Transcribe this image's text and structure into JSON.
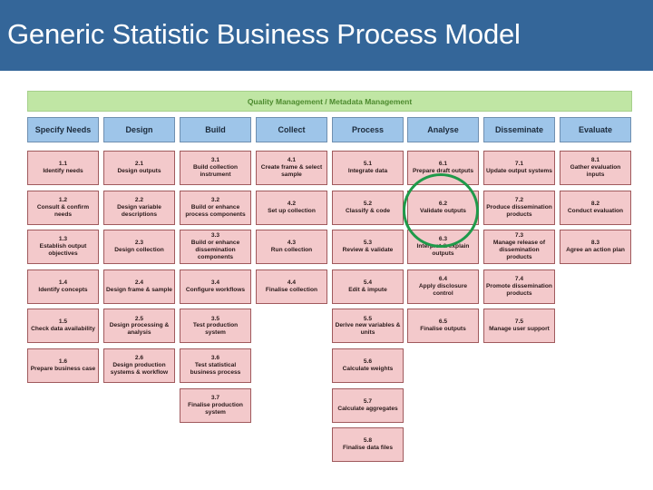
{
  "title": "Generic Statistic Business Process Model",
  "quality_bar": "Quality Management / Metadata Management",
  "colors": {
    "title_bg": "#346699",
    "quality_bg": "#c0e6a4",
    "phase_bg": "#9ec5e9",
    "subprocess_bg": "#f3c9cb",
    "highlight": "#1f9a4a"
  },
  "phases": [
    {
      "label": "Specify Needs",
      "subs": [
        {
          "num": "1.1",
          "label": "Identify needs"
        },
        {
          "num": "1.2",
          "label": "Consult & confirm needs"
        },
        {
          "num": "1.3",
          "label": "Establish output objectives"
        },
        {
          "num": "1.4",
          "label": "Identify concepts"
        },
        {
          "num": "1.5",
          "label": "Check data availability"
        },
        {
          "num": "1.6",
          "label": "Prepare business case"
        }
      ]
    },
    {
      "label": "Design",
      "subs": [
        {
          "num": "2.1",
          "label": "Design outputs"
        },
        {
          "num": "2.2",
          "label": "Design variable descriptions"
        },
        {
          "num": "2.3",
          "label": "Design collection"
        },
        {
          "num": "2.4",
          "label": "Design frame & sample"
        },
        {
          "num": "2.5",
          "label": "Design processing & analysis"
        },
        {
          "num": "2.6",
          "label": "Design production systems & workflow"
        }
      ]
    },
    {
      "label": "Build",
      "subs": [
        {
          "num": "3.1",
          "label": "Build collection instrument"
        },
        {
          "num": "3.2",
          "label": "Build or enhance process components"
        },
        {
          "num": "3.3",
          "label": "Build or enhance dissemination components"
        },
        {
          "num": "3.4",
          "label": "Configure workflows"
        },
        {
          "num": "3.5",
          "label": "Test production system"
        },
        {
          "num": "3.6",
          "label": "Test statistical business process"
        },
        {
          "num": "3.7",
          "label": "Finalise production system"
        }
      ]
    },
    {
      "label": "Collect",
      "subs": [
        {
          "num": "4.1",
          "label": "Create frame & select sample"
        },
        {
          "num": "4.2",
          "label": "Set up collection"
        },
        {
          "num": "4.3",
          "label": "Run collection"
        },
        {
          "num": "4.4",
          "label": "Finalise collection"
        }
      ]
    },
    {
      "label": "Process",
      "subs": [
        {
          "num": "5.1",
          "label": "Integrate data"
        },
        {
          "num": "5.2",
          "label": "Classify & code"
        },
        {
          "num": "5.3",
          "label": "Review & validate"
        },
        {
          "num": "5.4",
          "label": "Edit & impute"
        },
        {
          "num": "5.5",
          "label": "Derive new variables & units"
        },
        {
          "num": "5.6",
          "label": "Calculate weights"
        },
        {
          "num": "5.7",
          "label": "Calculate aggregates"
        },
        {
          "num": "5.8",
          "label": "Finalise data files"
        }
      ]
    },
    {
      "label": "Analyse",
      "subs": [
        {
          "num": "6.1",
          "label": "Prepare draft outputs"
        },
        {
          "num": "6.2",
          "label": "Validate outputs"
        },
        {
          "num": "6.3",
          "label": "Interpret & explain outputs"
        },
        {
          "num": "6.4",
          "label": "Apply disclosure control"
        },
        {
          "num": "6.5",
          "label": "Finalise outputs"
        }
      ]
    },
    {
      "label": "Disseminate",
      "subs": [
        {
          "num": "7.1",
          "label": "Update output systems"
        },
        {
          "num": "7.2",
          "label": "Produce dissemination products"
        },
        {
          "num": "7.3",
          "label": "Manage release of dissemination products"
        },
        {
          "num": "7.4",
          "label": "Promote dissemination products"
        },
        {
          "num": "7.5",
          "label": "Manage user support"
        }
      ]
    },
    {
      "label": "Evaluate",
      "subs": [
        {
          "num": "8.1",
          "label": "Gather evaluation inputs"
        },
        {
          "num": "8.2",
          "label": "Conduct evaluation"
        },
        {
          "num": "8.3",
          "label": "Agree an action plan"
        }
      ]
    }
  ],
  "highlighted": "6.2"
}
